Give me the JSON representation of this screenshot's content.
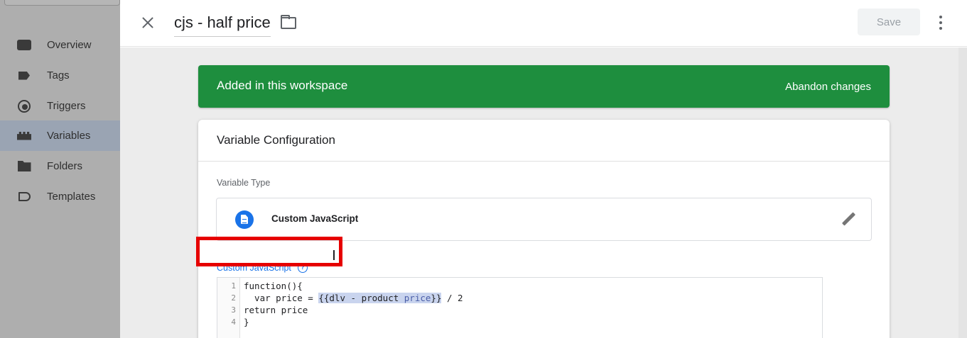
{
  "sidebar": {
    "items": [
      {
        "label": "Overview",
        "icon": "overview-icon",
        "active": false
      },
      {
        "label": "Tags",
        "icon": "tag-icon",
        "active": false
      },
      {
        "label": "Triggers",
        "icon": "trigger-icon",
        "active": false
      },
      {
        "label": "Variables",
        "icon": "variables-icon",
        "active": true
      },
      {
        "label": "Folders",
        "icon": "folder-icon",
        "active": false
      },
      {
        "label": "Templates",
        "icon": "template-icon",
        "active": false
      }
    ]
  },
  "header": {
    "title": "cjs - half price",
    "save_label": "Save"
  },
  "banner": {
    "text": "Added in this workspace",
    "action": "Abandon changes",
    "color": "#1e8e3e"
  },
  "card": {
    "title": "Variable Configuration",
    "variable_type_label": "Variable Type",
    "variable_type_name": "Custom JavaScript",
    "code_label": "Custom JavaScript",
    "help_glyph": "?",
    "code": {
      "line_numbers": [
        "1",
        "2",
        "3",
        "4"
      ],
      "line1": "function(){",
      "line2_prefix": "  var price = ",
      "line2_highlight_open": "{{dlv - product ",
      "line2_highlight_var": "price",
      "line2_highlight_close": "}}",
      "line2_suffix": " / 2",
      "line3": "return price",
      "line4": "}"
    }
  },
  "annotation": {
    "highlight_color": "#e60000"
  }
}
